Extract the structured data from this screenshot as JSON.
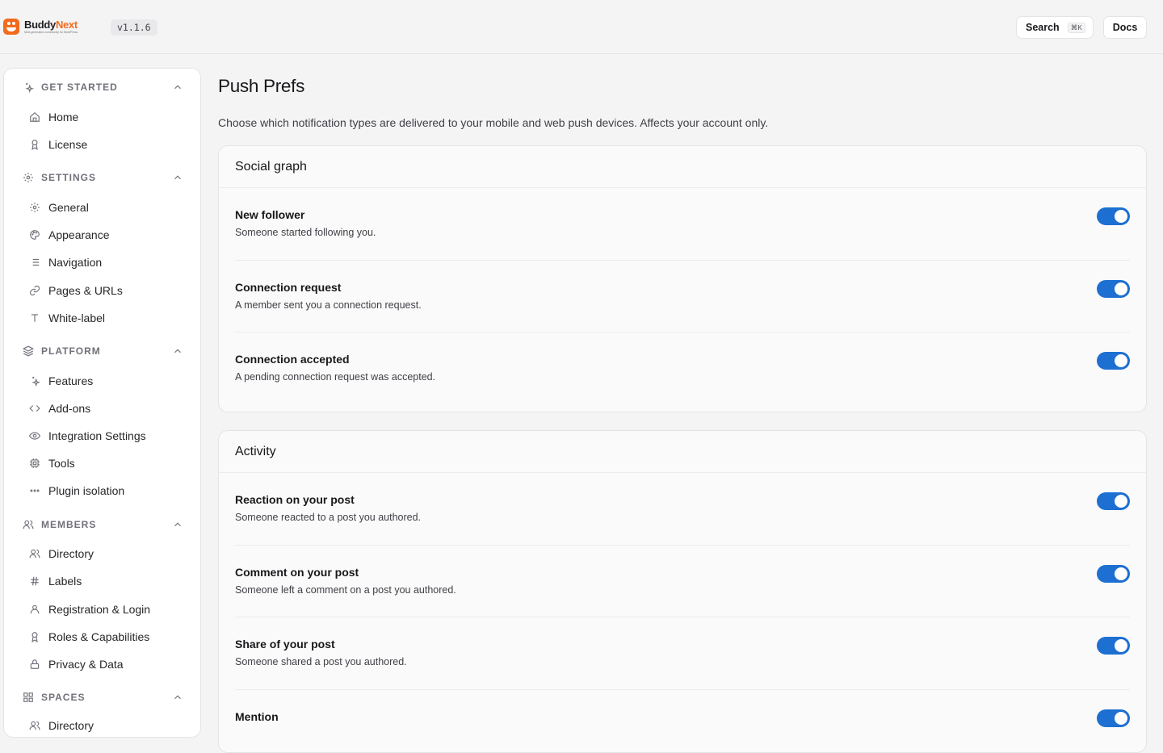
{
  "header": {
    "logo_word_a": "Buddy",
    "logo_word_b": "Next",
    "logo_tagline": "Next-generation community for WordPress",
    "version": "v1.1.6",
    "search_label": "Search",
    "search_shortcut": "⌘K",
    "docs_label": "Docs"
  },
  "sidebar": {
    "sections": [
      {
        "label": "GET STARTED",
        "icon": "sparkle-icon",
        "items": [
          {
            "label": "Home",
            "icon": "home-icon"
          },
          {
            "label": "License",
            "icon": "award-icon"
          }
        ]
      },
      {
        "label": "SETTINGS",
        "icon": "gear-icon",
        "items": [
          {
            "label": "General",
            "icon": "gear-icon"
          },
          {
            "label": "Appearance",
            "icon": "palette-icon"
          },
          {
            "label": "Navigation",
            "icon": "list-icon"
          },
          {
            "label": "Pages & URLs",
            "icon": "link-icon"
          },
          {
            "label": "White-label",
            "icon": "type-icon"
          }
        ]
      },
      {
        "label": "PLATFORM",
        "icon": "layers-icon",
        "items": [
          {
            "label": "Features",
            "icon": "sparkle-icon"
          },
          {
            "label": "Add-ons",
            "icon": "code-icon"
          },
          {
            "label": "Integration Settings",
            "icon": "eye-icon"
          },
          {
            "label": "Tools",
            "icon": "cpu-icon"
          },
          {
            "label": "Plugin isolation",
            "icon": "dots-icon"
          }
        ]
      },
      {
        "label": "MEMBERS",
        "icon": "users-icon",
        "items": [
          {
            "label": "Directory",
            "icon": "users-icon"
          },
          {
            "label": "Labels",
            "icon": "hash-icon"
          },
          {
            "label": "Registration & Login",
            "icon": "user-icon"
          },
          {
            "label": "Roles & Capabilities",
            "icon": "award-icon"
          },
          {
            "label": "Privacy & Data",
            "icon": "lock-icon"
          }
        ]
      },
      {
        "label": "SPACES",
        "icon": "grid-icon",
        "items": [
          {
            "label": "Directory",
            "icon": "users-icon"
          }
        ]
      }
    ]
  },
  "main": {
    "title": "Push Prefs",
    "description": "Choose which notification types are delivered to your mobile and web push devices. Affects your account only.",
    "cards": [
      {
        "title": "Social graph",
        "rows": [
          {
            "title": "New follower",
            "desc": "Someone started following you.",
            "enabled": true
          },
          {
            "title": "Connection request",
            "desc": "A member sent you a connection request.",
            "enabled": true
          },
          {
            "title": "Connection accepted",
            "desc": "A pending connection request was accepted.",
            "enabled": true
          }
        ]
      },
      {
        "title": "Activity",
        "rows": [
          {
            "title": "Reaction on your post",
            "desc": "Someone reacted to a post you authored.",
            "enabled": true
          },
          {
            "title": "Comment on your post",
            "desc": "Someone left a comment on a post you authored.",
            "enabled": true
          },
          {
            "title": "Share of your post",
            "desc": "Someone shared a post you authored.",
            "enabled": true
          },
          {
            "title": "Mention",
            "desc": "",
            "enabled": true
          }
        ]
      }
    ]
  },
  "colors": {
    "accent": "#1d6fd1",
    "brand": "#f26b1d"
  }
}
